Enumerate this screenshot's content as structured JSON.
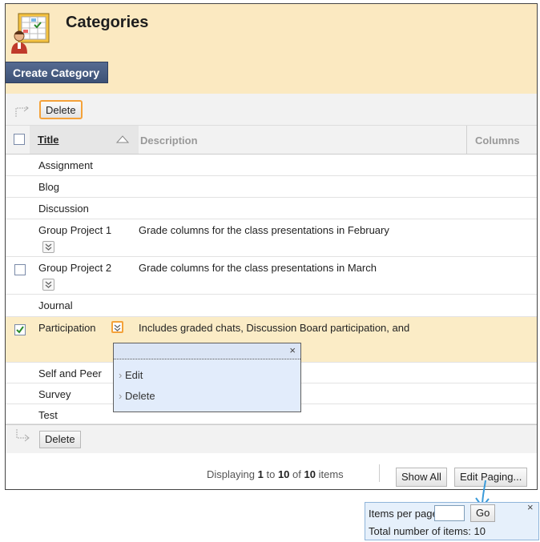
{
  "header": {
    "title": "Categories",
    "create_button": "Create Category"
  },
  "toolbar": {
    "delete_label": "Delete"
  },
  "table": {
    "columns": {
      "title": "Title",
      "description": "Description",
      "columns": "Columns"
    },
    "rows": [
      {
        "name": "Assignment",
        "description": ""
      },
      {
        "name": "Blog",
        "description": ""
      },
      {
        "name": "Discussion",
        "description": ""
      },
      {
        "name": "Group Project 1",
        "description": "Grade columns for the class presentations in February"
      },
      {
        "name": "Group Project 2",
        "description": "Grade columns for the class presentations in March"
      },
      {
        "name": "Journal",
        "description": ""
      },
      {
        "name": "Participation",
        "description": "Includes graded chats, Discussion Board participation, and"
      },
      {
        "name": "Self and Peer",
        "description": ""
      },
      {
        "name": "Survey",
        "description": ""
      },
      {
        "name": "Test",
        "description": ""
      }
    ]
  },
  "context_menu": {
    "items": [
      "Edit",
      "Delete"
    ],
    "close": "×"
  },
  "footer": {
    "displaying": "Displaying",
    "from": "1",
    "to_word": "to",
    "to": "10",
    "of_word": "of",
    "total": "10",
    "items_word": "items",
    "show_all": "Show All",
    "edit_paging": "Edit Paging..."
  },
  "paging_popup": {
    "items_per_page_label": "Items per page:",
    "go": "Go",
    "close": "×",
    "total_label": "Total number of items: 10"
  },
  "colors": {
    "header_bg": "#fbe9c1",
    "button_blue": "#3d5176",
    "highlight_orange": "#f4a23a",
    "selected_row": "#fbecc6",
    "callout_blue": "#3a9ad9"
  },
  "icons": {
    "header": "gradebook-categories-icon",
    "sort": "sort-ascending-icon",
    "row_menu": "chevron-down-icon"
  }
}
